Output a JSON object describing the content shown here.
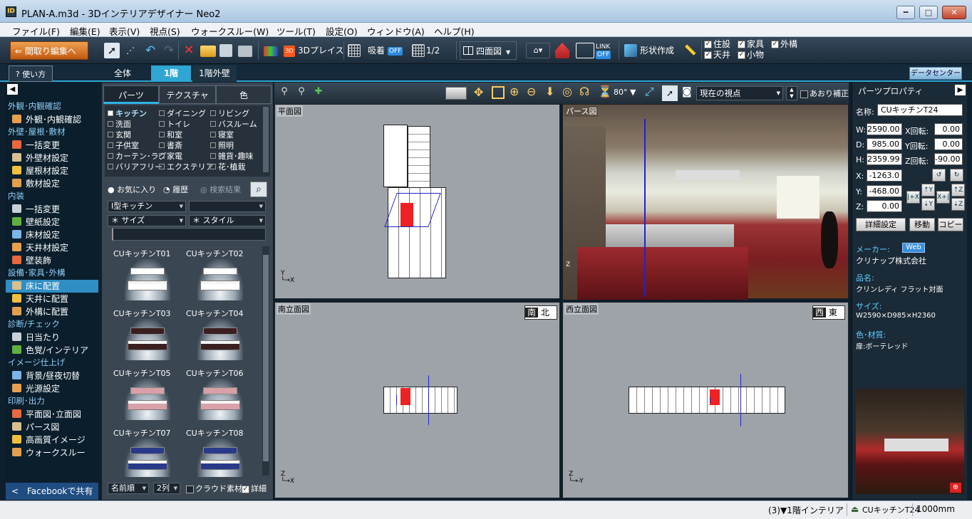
{
  "window": {
    "title": "PLAN-A.m3d - 3Dインテリアデザイナー Neo2",
    "min": "━",
    "max": "□",
    "close": "✕"
  },
  "menu": [
    "ファイル(F)",
    "編集(E)",
    "表示(V)",
    "視点(S)",
    "ウォークスルー(W)",
    "ツール(T)",
    "設定(O)",
    "ウィンドウ(A)",
    "ヘルプ(H)"
  ],
  "toolbar": {
    "back_label": "間取り編集へ",
    "place3d_label": "3Dプレイス",
    "snap_label": "吸着",
    "snap_state": "OFF",
    "grid_label": "1/2",
    "view4_label": "四面図",
    "link_label": "LINK",
    "link_state": "OFF",
    "shape_label": "形状作成",
    "checks": [
      {
        "label": "住設",
        "checked": true
      },
      {
        "label": "天井",
        "checked": true
      },
      {
        "label": "家具",
        "checked": true
      },
      {
        "label": "小物",
        "checked": true
      },
      {
        "label": "外構",
        "checked": true
      }
    ]
  },
  "tabrow": {
    "help_label": "使い方",
    "tabs": [
      "全体",
      "1階",
      "1階外壁"
    ],
    "active_tab": "1階",
    "data_center": "データセンター"
  },
  "sidebar": {
    "sections": [
      {
        "title": "外観･内観確認",
        "items": [
          "外観･内観確認"
        ]
      },
      {
        "title": "外壁･屋根･敷材",
        "items": [
          "一括変更",
          "外壁材設定",
          "屋根材設定",
          "敷材設定"
        ]
      },
      {
        "title": "内装",
        "items": [
          "一括変更",
          "壁紙設定",
          "床材設定",
          "天井材設定",
          "壁装飾"
        ]
      },
      {
        "title": "設備･家具･外構",
        "items": [
          "床に配置",
          "天井に配置",
          "外構に配置"
        ]
      },
      {
        "title": "診断/チェック",
        "items": [
          "日当たり",
          "色覚/インテリア"
        ]
      },
      {
        "title": "イメージ仕上げ",
        "items": [
          "背景/昼夜切替",
          "光源設定"
        ]
      },
      {
        "title": "印刷･出力",
        "items": [
          "平面図･立面図",
          "パース図",
          "高画質イメージ",
          "ウォークスルー"
        ]
      }
    ],
    "selected": "床に配置",
    "facebook_label": "Facebookで共有"
  },
  "parts": {
    "tabs": [
      "パーツ",
      "テクスチャ",
      "色"
    ],
    "categories": [
      [
        "キッチン",
        "ダイニング",
        "リビング"
      ],
      [
        "洗面",
        "トイレ",
        "バスルーム"
      ],
      [
        "玄関",
        "和室",
        "寝室"
      ],
      [
        "子供室",
        "書斎",
        "照明"
      ],
      [
        "カーテン･ラグ",
        "家電",
        "雑貨･趣味"
      ],
      [
        "バリアフリー",
        "エクステリア",
        "花･植栽"
      ]
    ],
    "filters": [
      "お気に入り",
      "履歴",
      "検索結果"
    ],
    "dd1": "I型キッチン",
    "dd2": "",
    "dd3": "＊ サイズ",
    "dd4": "＊ スタイル",
    "items": [
      "CUキッチンT01",
      "CUキッチンT02",
      "CUキッチンT03",
      "CUキッチンT04",
      "CUキッチンT05",
      "CUキッチンT06",
      "CUキッチンT07",
      "CUキッチンT08"
    ],
    "item_colors": [
      "#ffffff",
      "#ffffff",
      "#3b1f20",
      "#3b1f20",
      "#d8a0a8",
      "#d8a0a8",
      "#2a3a8a",
      "#2a3a8a"
    ],
    "sort_label": "名前順",
    "cols_label": "2列",
    "cloud_label": "クラウド素材",
    "detail_label": "詳細"
  },
  "viewtb": {
    "angle": "80°",
    "viewpoint": "現在の視点",
    "tilt_label": "あおり補正"
  },
  "views": {
    "plan": "平面図",
    "perspective": "パース図",
    "south": "南立面図",
    "west": "西立面図",
    "south_dir": [
      "南",
      "北"
    ],
    "west_dir": [
      "西",
      "東"
    ],
    "axis": {
      "y": "Y",
      "x": "X",
      "z": "Z",
      "ny": "-Y"
    }
  },
  "props": {
    "title": "パーツプロパティ",
    "name_label": "名称:",
    "name": "CUキッチンT24",
    "W": "2590.00",
    "D": "985.00",
    "H": "2359.99",
    "XR": "0.00",
    "YR": "0.00",
    "ZR": "-90.00",
    "X": "-1263.0",
    "Y": "-468.00",
    "Z": "0.00",
    "rot_labels": [
      "X回転:",
      "Y回転:",
      "Z回転:"
    ],
    "buttons": [
      "詳細設定",
      "移動",
      "コピー"
    ],
    "maker_label": "メーカー:",
    "web": "Web",
    "maker": "クリナップ株式会社",
    "product_label": "品名:",
    "product": "クリンレディ フラット対面",
    "size_label": "サイズ:",
    "size": "W2590×D985×H2360",
    "color_label": "色･材質:",
    "color": "扉:ボーテレッド"
  },
  "status": {
    "layer": "(3)▼1階インテリア",
    "part": "CUキッチンT24",
    "unit": "1000mm"
  }
}
